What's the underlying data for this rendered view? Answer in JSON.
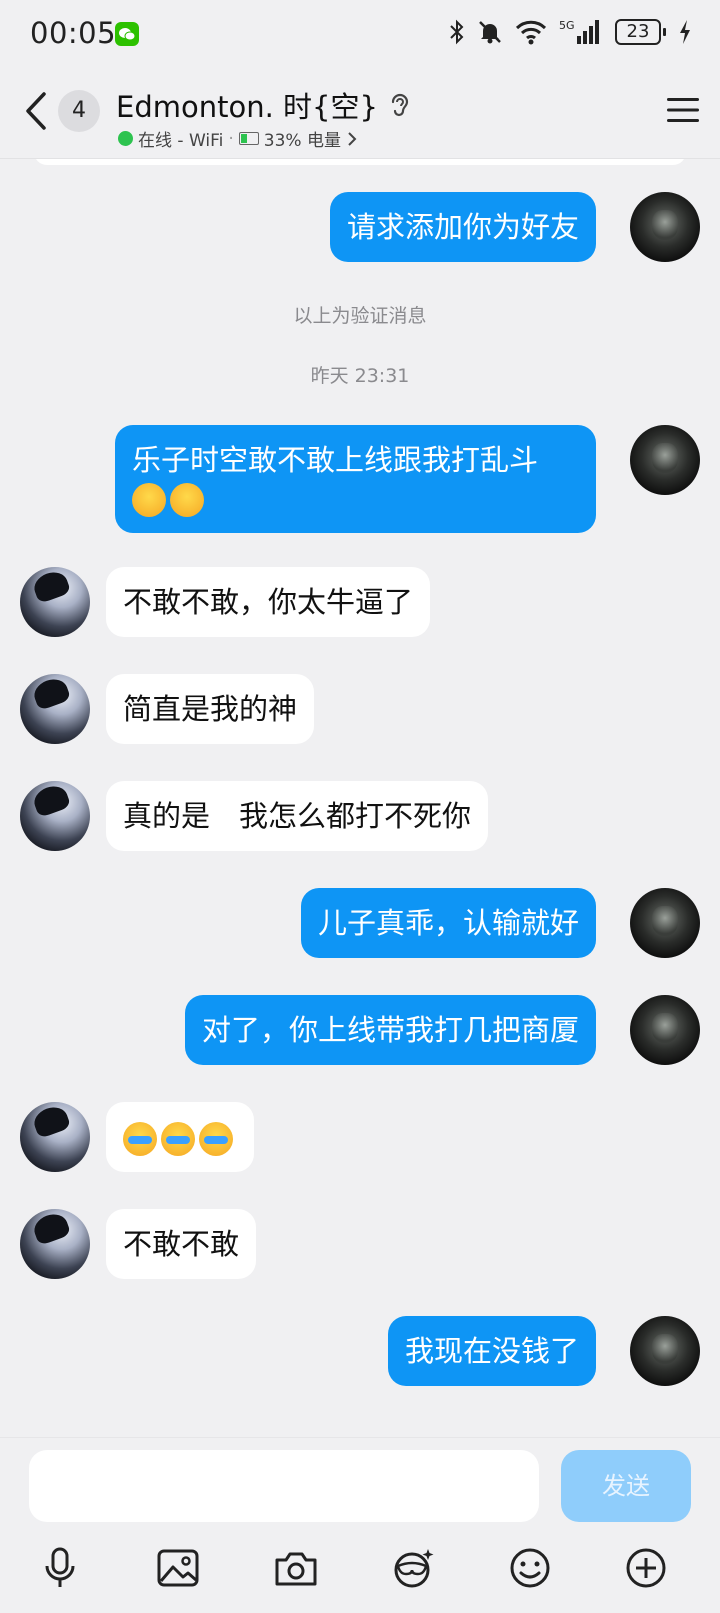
{
  "status_bar": {
    "time": "00:05",
    "icons": [
      "wechat-icon",
      "bluetooth-icon",
      "mute-icon",
      "wifi-icon",
      "5g-signal-icon"
    ],
    "battery": "23"
  },
  "header": {
    "back_icon": "chevron-left-icon",
    "unread_count": "4",
    "title": "Edmonton. 时{空}",
    "hearing_icon": "ear-icon",
    "online_status": "在线 - WiFi",
    "battery_status": "33% 电量",
    "menu_icon": "hamburger-icon",
    "accent_color": "#0e95f5"
  },
  "messages": [
    {
      "from": "me",
      "text": "请求添加你为好友"
    },
    {
      "type": "system",
      "text": "以上为验证消息"
    },
    {
      "type": "timestamp",
      "text": "昨天 23:31"
    },
    {
      "from": "me",
      "text": "乐子时空敢不敢上线跟我打乱斗",
      "emoji": "😂😂"
    },
    {
      "from": "other",
      "text": "不敢不敢，你太牛逼了"
    },
    {
      "from": "other",
      "text": "简直是我的神"
    },
    {
      "from": "other",
      "text": "真的是　我怎么都打不死你"
    },
    {
      "from": "me",
      "text": "儿子真乖，认输就好"
    },
    {
      "from": "me",
      "text": "对了，你上线带我打几把商厦"
    },
    {
      "from": "other",
      "text": "",
      "emoji": "😭😭😭"
    },
    {
      "from": "other",
      "text": "不敢不敢"
    },
    {
      "from": "me",
      "text": "我现在没钱了"
    }
  ],
  "input_bar": {
    "placeholder": "",
    "send_label": "发送",
    "tools": [
      "microphone-icon",
      "image-icon",
      "camera-icon",
      "mask-icon",
      "emoji-icon",
      "plus-icon"
    ]
  }
}
